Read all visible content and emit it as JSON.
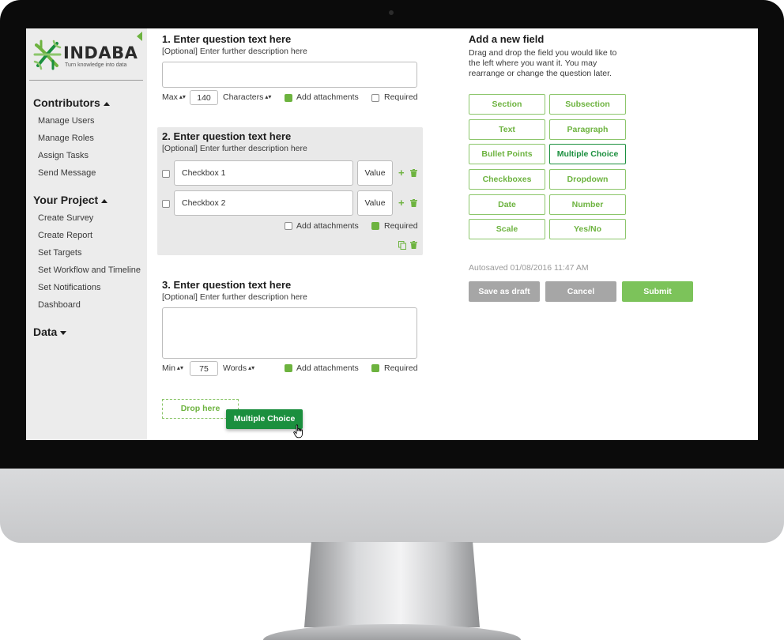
{
  "brand": {
    "name": "INDABA",
    "tagline": "Turn knowledge into data",
    "accent": "#6db33f",
    "accent_dark": "#1b8f3e"
  },
  "sidebar": {
    "sections": [
      {
        "label": "Contributors",
        "state": "expanded",
        "items": [
          "Manage Users",
          "Manage Roles",
          "Assign Tasks",
          "Send Message"
        ]
      },
      {
        "label": "Your Project",
        "state": "expanded",
        "items": [
          "Create Survey",
          "Create Report",
          "Set Targets",
          "Set Workflow and Timeline",
          "Set Notifications",
          "Dashboard"
        ]
      },
      {
        "label": "Data",
        "state": "collapsed",
        "items": []
      }
    ]
  },
  "questions": [
    {
      "title": "1. Enter question text here",
      "description": "[Optional] Enter further description here",
      "limit_label": "Max",
      "limit_value": "140",
      "unit_label": "Characters",
      "attachments_label": "Add attachments",
      "attachments_checked": true,
      "required_label": "Required",
      "required_checked": false
    },
    {
      "title": "2. Enter question text here",
      "description": "[Optional] Enter further description here",
      "options": [
        {
          "label": "Checkbox 1",
          "value": "Value"
        },
        {
          "label": "Checkbox 2",
          "value": "Value"
        }
      ],
      "attachments_label": "Add attachments",
      "attachments_checked": false,
      "required_label": "Required",
      "required_checked": true
    },
    {
      "title": "3. Enter question text here",
      "description": "[Optional] Enter further description here",
      "limit_label": "Min",
      "limit_value": "75",
      "unit_label": "Words",
      "attachments_label": "Add attachments",
      "attachments_checked": true,
      "required_label": "Required",
      "required_checked": true
    }
  ],
  "drop_zone": {
    "label": "Drop here"
  },
  "drag_chip": {
    "label": "Multiple Choice"
  },
  "panel": {
    "title": "Add a new field",
    "description": "Drag and drop the field you would like to the left where you want it. You may rearrange or change the question later.",
    "fields": [
      "Section",
      "Subsection",
      "Text",
      "Paragraph",
      "Bullet Points",
      "Multiple Choice",
      "Checkboxes",
      "Dropdown",
      "Date",
      "Number",
      "Scale",
      "Yes/No"
    ],
    "active_field": "Multiple Choice",
    "autosave": "Autosaved 01/08/2016 11:47 AM",
    "buttons": {
      "draft": "Save as draft",
      "cancel": "Cancel",
      "submit": "Submit"
    },
    "colors": {
      "draft": "#a6a6a6",
      "cancel": "#a6a6a6",
      "submit": "#7cc35a"
    }
  }
}
